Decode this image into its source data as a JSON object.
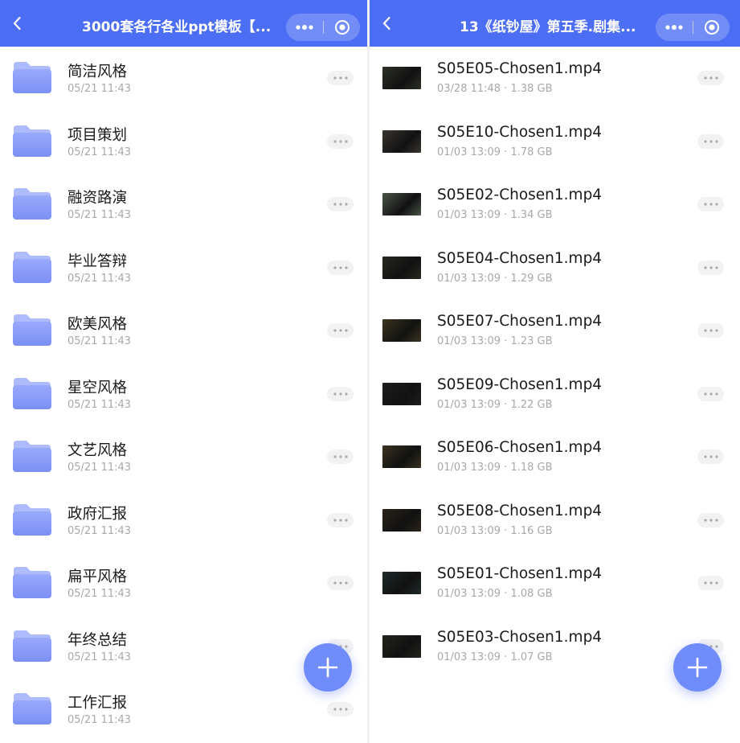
{
  "colors": {
    "accent": "#4c6ef5",
    "fab": "#6f8cfa",
    "folder_front": "#8196f7",
    "folder_back": "#a5b3fb"
  },
  "icons": {
    "back": "chevron-left-icon",
    "more": "more-dots-icon",
    "close": "target-circle-icon",
    "add": "plus-icon",
    "folder": "folder-icon",
    "video": "video-thumbnail"
  },
  "left": {
    "title": "3000套各行各业ppt模板【...",
    "items": [
      {
        "name": "简洁风格",
        "meta": "05/21 11:43"
      },
      {
        "name": "项目策划",
        "meta": "05/21 11:43"
      },
      {
        "name": "融资路演",
        "meta": "05/21 11:43"
      },
      {
        "name": "毕业答辩",
        "meta": "05/21 11:43"
      },
      {
        "name": "欧美风格",
        "meta": "05/21 11:43"
      },
      {
        "name": "星空风格",
        "meta": "05/21 11:43"
      },
      {
        "name": "文艺风格",
        "meta": "05/21 11:43"
      },
      {
        "name": "政府汇报",
        "meta": "05/21 11:43"
      },
      {
        "name": "扁平风格",
        "meta": "05/21 11:43"
      },
      {
        "name": "年终总结",
        "meta": "05/21 11:43"
      },
      {
        "name": "工作汇报",
        "meta": "05/21 11:43"
      }
    ]
  },
  "right": {
    "title": "13《纸钞屋》第五季.剧集...",
    "items": [
      {
        "name": "S05E05-Chosen1.mp4",
        "meta": "03/28 11:48 · 1.38 GB",
        "thumb": "#2c3128"
      },
      {
        "name": "S05E10-Chosen1.mp4",
        "meta": "01/03 13:09 · 1.78 GB",
        "thumb": "#3a3530"
      },
      {
        "name": "S05E02-Chosen1.mp4",
        "meta": "01/03 13:09 · 1.34 GB",
        "thumb": "#4a5448"
      },
      {
        "name": "S05E04-Chosen1.mp4",
        "meta": "01/03 13:09 · 1.29 GB",
        "thumb": "#262a20"
      },
      {
        "name": "S05E07-Chosen1.mp4",
        "meta": "01/03 13:09 · 1.23 GB",
        "thumb": "#3b3420"
      },
      {
        "name": "S05E09-Chosen1.mp4",
        "meta": "01/03 13:09 · 1.22 GB",
        "thumb": "#1c1f1c"
      },
      {
        "name": "S05E06-Chosen1.mp4",
        "meta": "01/03 13:09 · 1.18 GB",
        "thumb": "#3a3220"
      },
      {
        "name": "S05E08-Chosen1.mp4",
        "meta": "01/03 13:09 · 1.16 GB",
        "thumb": "#2a241a"
      },
      {
        "name": "S05E01-Chosen1.mp4",
        "meta": "01/03 13:09 · 1.08 GB",
        "thumb": "#1f2a2a"
      },
      {
        "name": "S05E03-Chosen1.mp4",
        "meta": "01/03 13:09 · 1.07 GB",
        "thumb": "#23241c"
      }
    ]
  }
}
